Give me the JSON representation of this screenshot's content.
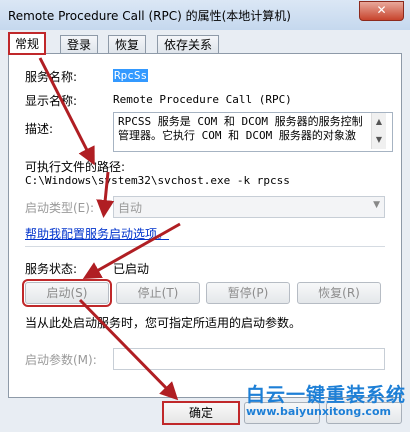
{
  "window": {
    "title": "Remote Procedure Call (RPC) 的属性(本地计算机)",
    "close_glyph": "✕"
  },
  "tabs": [
    "常规",
    "登录",
    "恢复",
    "依存关系"
  ],
  "general": {
    "service_name_label": "服务名称:",
    "service_name_value": "RpcSs",
    "display_name_label": "显示名称:",
    "display_name_value": "Remote Procedure Call (RPC)",
    "description_label": "描述:",
    "description_line1": "RPCSS 服务是 COM 和 DCOM 服务器的服务控制",
    "description_line2": "管理器。它执行 COM 和 DCOM 服务器的对象激",
    "exe_path_label": "可执行文件的路径:",
    "exe_path_value": "C:\\Windows\\system32\\svchost.exe -k rpcss",
    "startup_type_label": "启动类型(E):",
    "startup_type_value": "自动",
    "help_link": "帮助我配置服务启动选项。",
    "status_label": "服务状态:",
    "status_value": "已启动",
    "buttons": [
      "启动(S)",
      "停止(T)",
      "暂停(P)",
      "恢复(R)"
    ],
    "hint": "当从此处启动服务时，您可指定所适用的启动参数。",
    "start_params_label": "启动参数(M):",
    "start_params_value": ""
  },
  "footer": {
    "ok_label": "确定"
  },
  "watermark": {
    "brand": "白云一键重装系统",
    "url": "www.baiyunxitong.com"
  },
  "colors": {
    "highlight_red": "#c0282a",
    "link_blue": "#0033cc",
    "selection_blue": "#3399ff"
  }
}
